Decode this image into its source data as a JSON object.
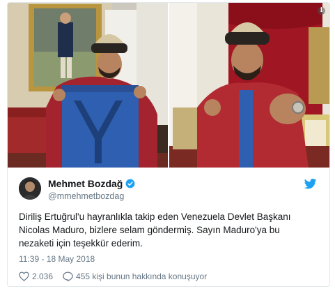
{
  "tweet": {
    "author_name": "Mehmet Bozdağ",
    "author_handle": "@mmehmetbozdag",
    "text_lines": [
      "Diriliş Ertuğrul'u hayranlıkla takip eden Venezuela Devlet Başkanı",
      "Nicolas Maduro, bizlere selam göndermiş. Sayın Maduro'ya  bu",
      "nezaketi için teşekkür ederim."
    ],
    "timestamp": "11:39 - 18 May 2018",
    "likes": "2.036",
    "conversation": "455 kişi bunun hakkında konuşuyor"
  },
  "media": {
    "info_glyph": "i"
  },
  "colors": {
    "verified": "#1da1f2",
    "twitter_bird": "#1da1f2",
    "secondary_text": "#657786",
    "primary_text": "#14171a"
  },
  "icons": [
    "info-icon",
    "verified-badge-icon",
    "twitter-bird-icon",
    "heart-icon",
    "reply-bubble-icon"
  ]
}
